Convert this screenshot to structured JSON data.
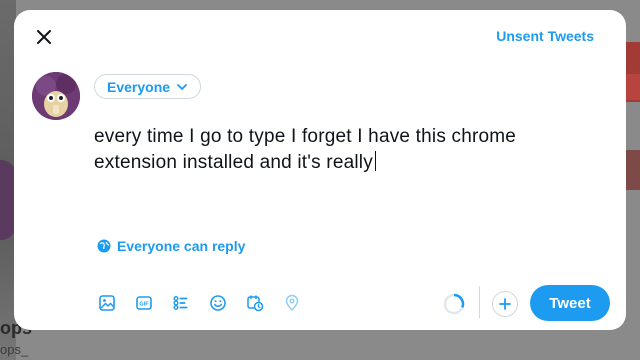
{
  "background": {
    "bottom_title_fragment": "ops",
    "bottom_sub_fragment": "ops_"
  },
  "modal": {
    "close_icon": "close-icon",
    "unsent_label": "Unsent Tweets",
    "audience_label": "Everyone",
    "compose_text_line1": "every time I go to type I forget I have this chrome",
    "compose_text_line2": "extension installed and it's really",
    "reply_setting_label": "Everyone can reply",
    "toolbar_icons": [
      "image-icon",
      "gif-icon",
      "poll-icon",
      "emoji-icon",
      "schedule-icon",
      "location-icon"
    ],
    "add_icon": "plus-icon",
    "tweet_button_label": "Tweet"
  },
  "colors": {
    "accent": "#1d9bf0",
    "text": "#0f1419",
    "border": "#cfd9de"
  }
}
